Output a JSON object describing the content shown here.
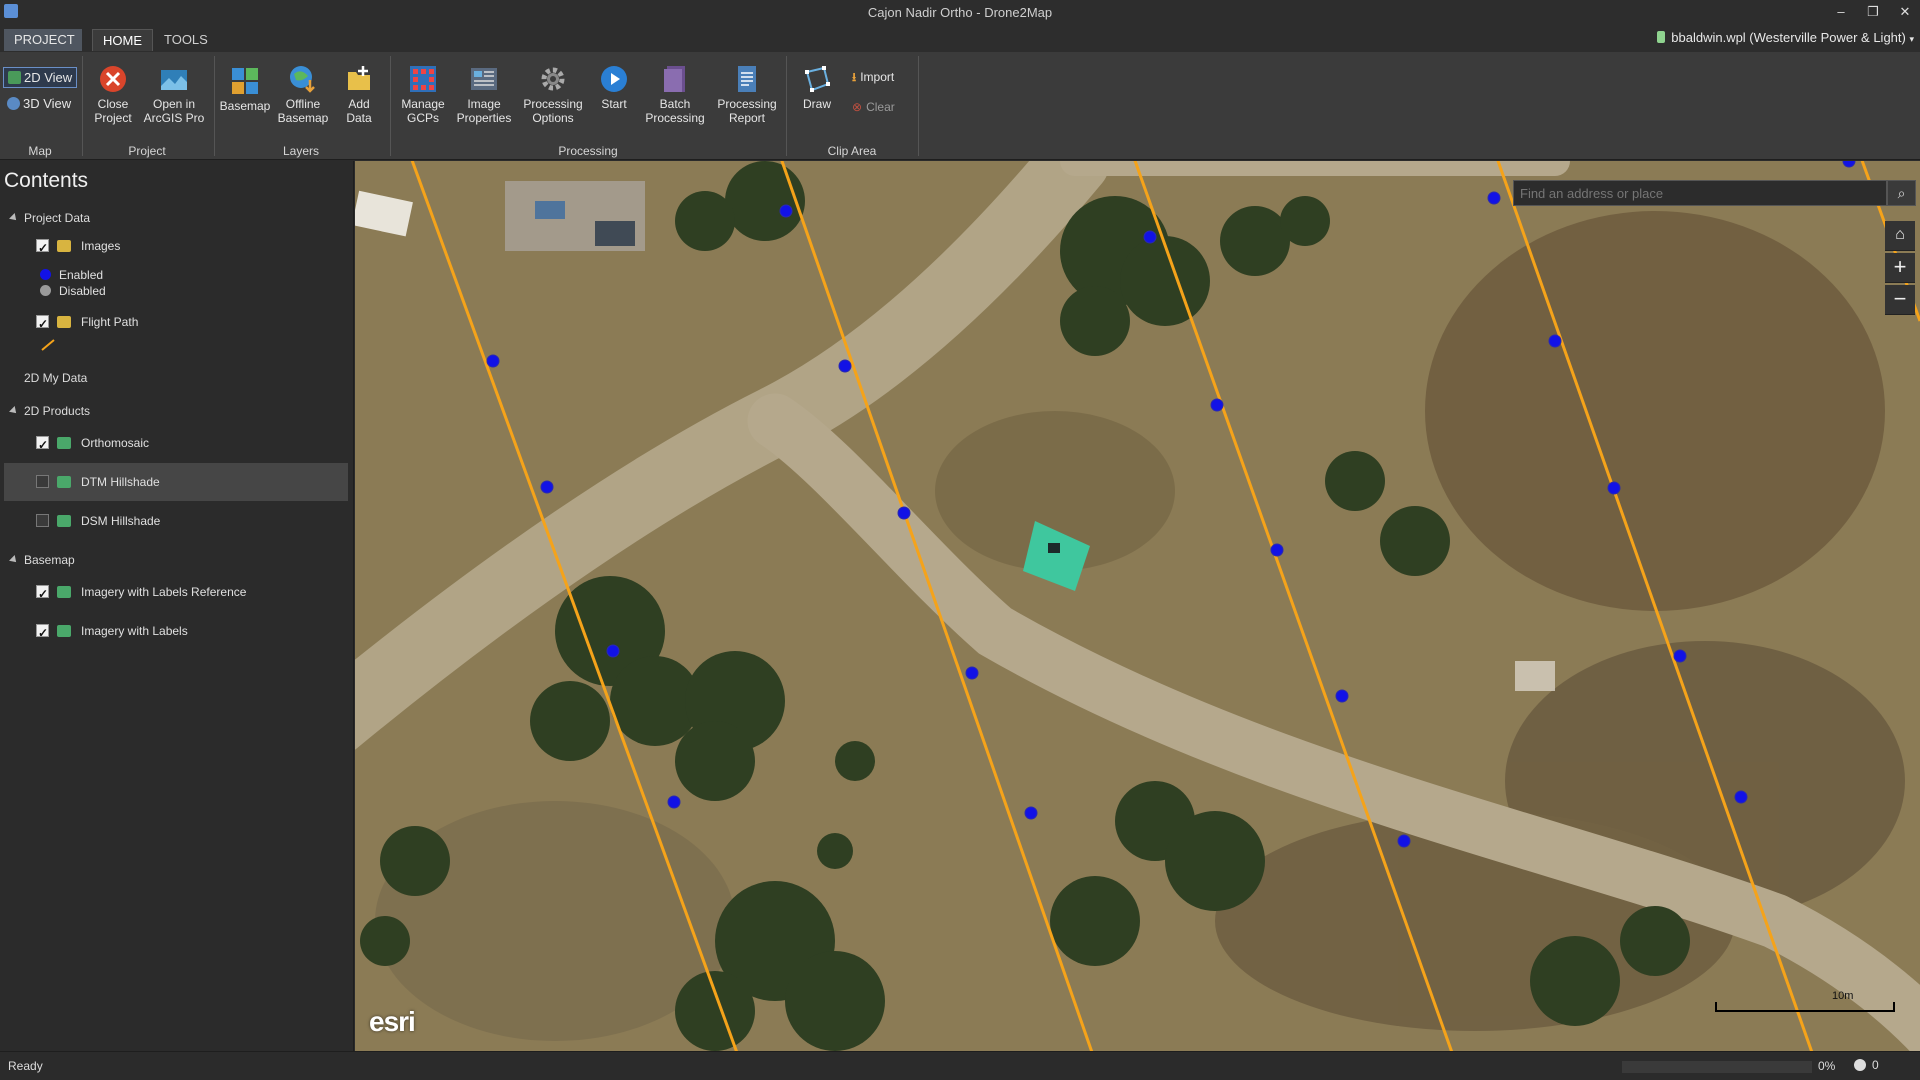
{
  "window": {
    "title": "Cajon Nadir Ortho - Drone2Map",
    "minimize": "–",
    "restore": "❐",
    "close": "✕"
  },
  "tabs": [
    "PROJECT",
    "HOME",
    "TOOLS"
  ],
  "user": "bbaldwin.wpl (Westerville Power & Light)",
  "ribbon": {
    "map": {
      "view_2d": "2D View",
      "view_3d": "3D View",
      "label": "Map"
    },
    "project": {
      "close": "Close\nProject",
      "open": "Open in\nArcGIS Pro",
      "label": "Project"
    },
    "layers": {
      "basemap": "Basemap",
      "offline": "Offline\nBasemap",
      "add_data": "Add\nData",
      "label": "Layers"
    },
    "processing": {
      "gcps": "Manage\nGCPs",
      "image_props": "Image\nProperties",
      "options": "Processing\nOptions",
      "start": "Start",
      "batch": "Batch\nProcessing",
      "report": "Processing\nReport",
      "label": "Processing"
    },
    "clip": {
      "draw": "Draw",
      "import": "Import",
      "clear": "Clear",
      "label": "Clip Area"
    }
  },
  "contents": {
    "title": "Contents",
    "project_data": "Project Data",
    "images": "Images",
    "enabled": "Enabled",
    "disabled": "Disabled",
    "flight_path": "Flight Path",
    "my_data": "2D My Data",
    "products": "2D Products",
    "orthomosaic": "Orthomosaic",
    "dtm": "DTM Hillshade",
    "dsm": "DSM Hillshade",
    "basemap": "Basemap",
    "imagery_ref": "Imagery with Labels Reference",
    "imagery": "Imagery with Labels"
  },
  "map": {
    "search_placeholder": "Find an address or place",
    "attribution": "esri",
    "scale_label": "10m",
    "colors": {
      "flight_path": "#f5a31a",
      "image_point": "#1212e6",
      "gcp_target": "#3fc79e"
    }
  },
  "status": {
    "text": "Ready",
    "progress": "0%",
    "jobs": "0"
  }
}
